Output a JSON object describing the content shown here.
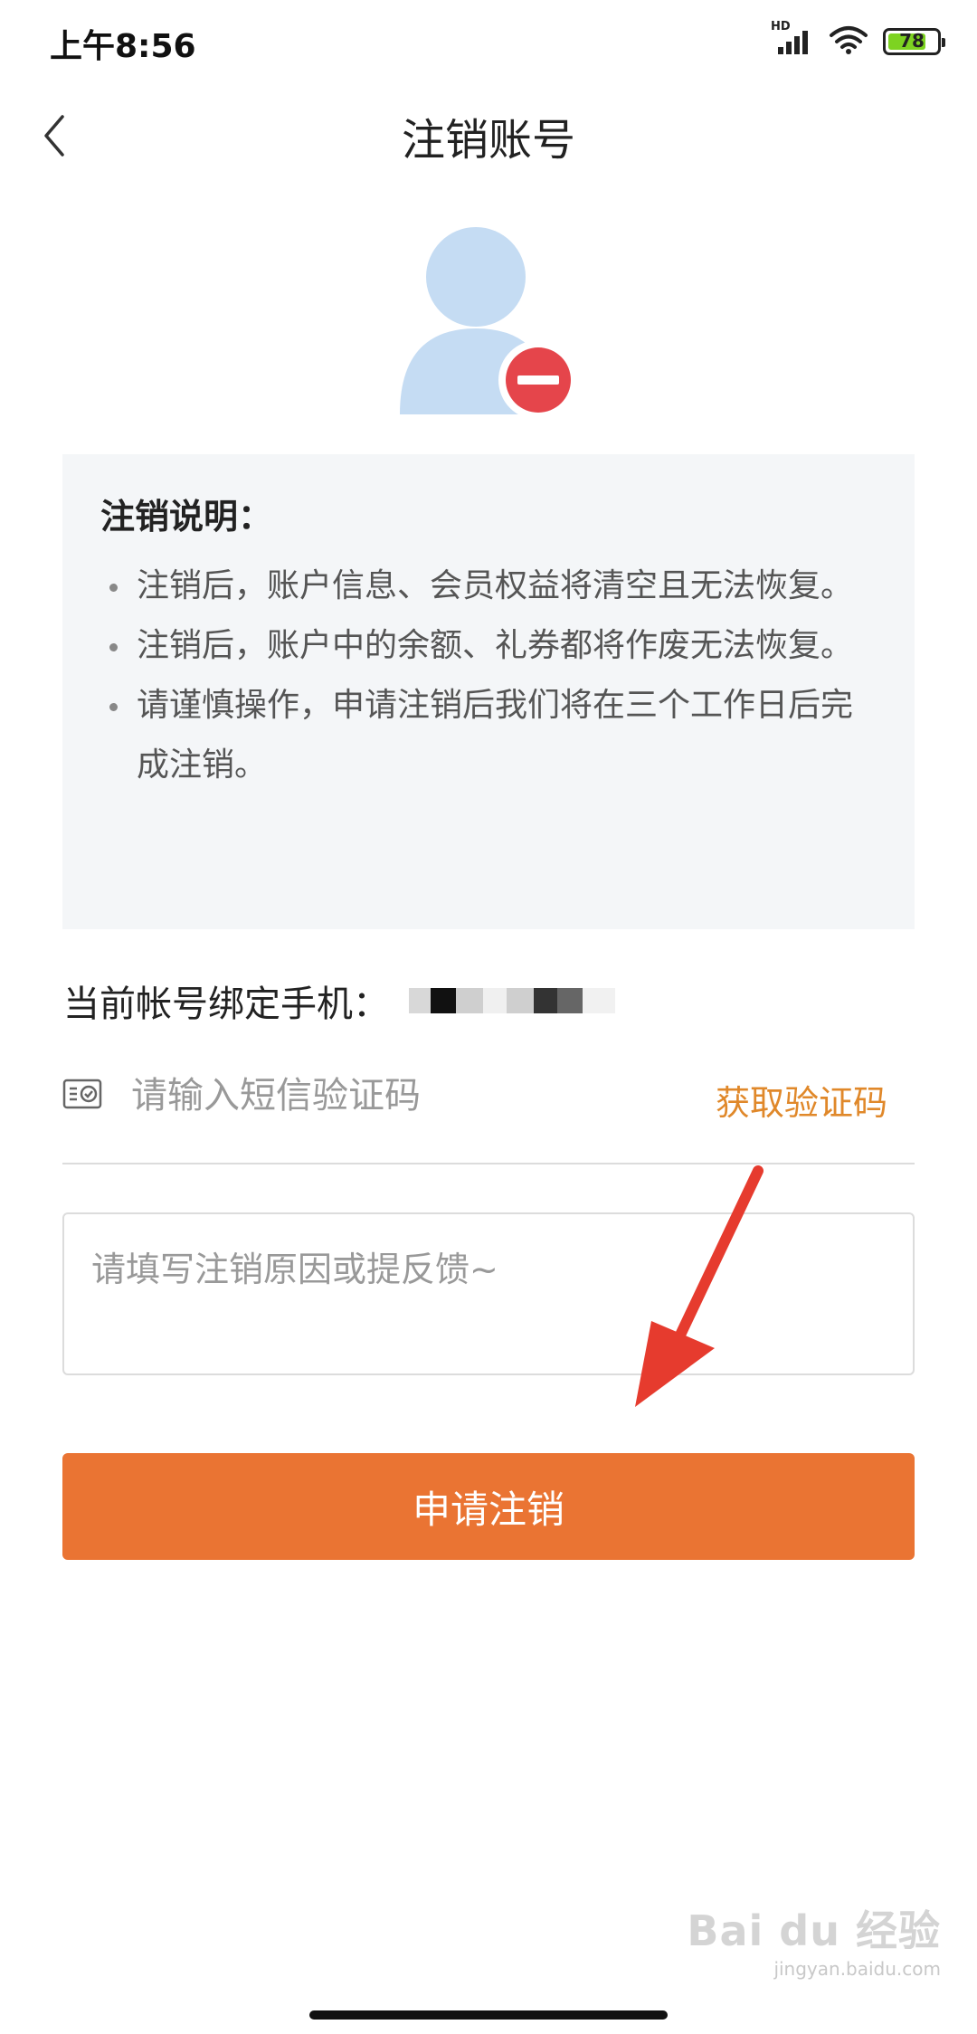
{
  "status_bar": {
    "time": "上午8:56",
    "network_label": "HD",
    "battery_level": "78",
    "battery_fraction": 0.78
  },
  "nav": {
    "title": "注销账号",
    "back_icon": "chevron-left-icon"
  },
  "notice": {
    "title": "注销说明：",
    "items": [
      "注销后，账户信息、会员权益将清空且无法恢复。",
      "注销后，账户中的余额、礼券都将作废无法恢复。",
      "请谨慎操作，申请注销后我们将在三个工作日后完成注销。"
    ]
  },
  "phone": {
    "label": "当前帐号绑定手机："
  },
  "sms": {
    "placeholder": "请输入短信验证码",
    "value": "",
    "get_code_label": "获取验证码",
    "icon": "sms-code-icon"
  },
  "reason": {
    "placeholder": "请填写注销原因或提反馈~",
    "value": ""
  },
  "submit": {
    "label": "申请注销"
  },
  "watermark": {
    "text": "Bai du 经验",
    "url": "jingyan.baidu.com"
  },
  "colors": {
    "accent": "#ea7433",
    "link": "#e0882a",
    "avatar": "#c5dcf3",
    "danger": "#e5454b",
    "notice_bg": "#f4f6f8",
    "arrow": "#e63b2e"
  }
}
